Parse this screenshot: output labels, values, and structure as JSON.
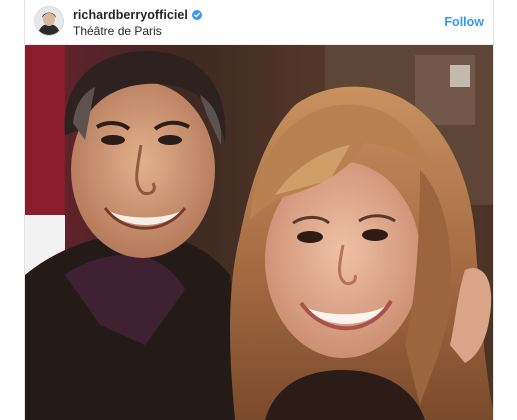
{
  "post": {
    "username": "richardberryofficiel",
    "location": "Théâtre de Paris",
    "follow_label": "Follow",
    "verified": true
  },
  "colors": {
    "follow_blue": "#3897f0",
    "verified_blue": "#3897f0",
    "text_dark": "#262626"
  },
  "icons": {
    "verified": "verified-badge-icon",
    "avatar": "profile-avatar"
  },
  "media": {
    "type": "photo",
    "subject": "selfie"
  }
}
